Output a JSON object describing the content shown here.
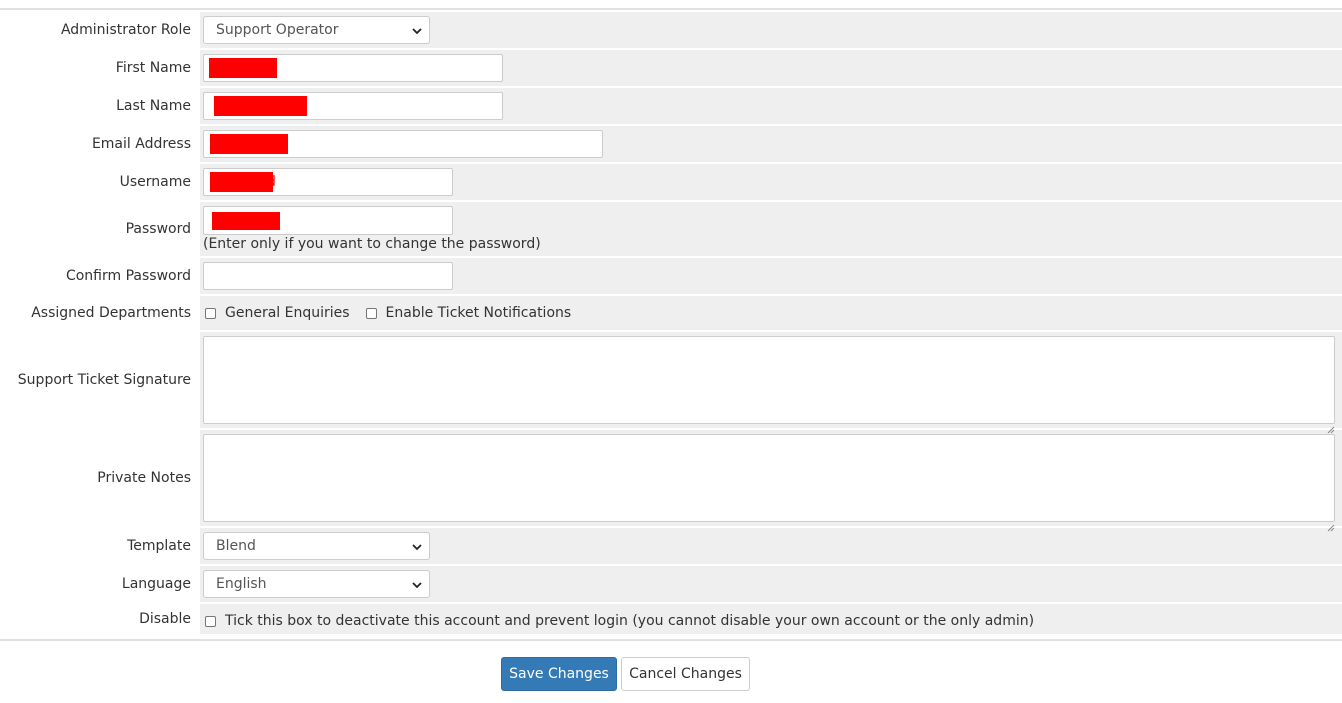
{
  "fields": {
    "admin_role": {
      "label": "Administrator Role",
      "value": "Support Operator"
    },
    "first_name": {
      "label": "First Name",
      "value": "Redacted"
    },
    "last_name": {
      "label": "Last Name",
      "value": "Redacted"
    },
    "email": {
      "label": "Email Address",
      "value": "Redacted"
    },
    "username": {
      "label": "Username",
      "value": "Redacted"
    },
    "password": {
      "label": "Password",
      "value": "Redacted",
      "help": "(Enter only if you want to change the password)"
    },
    "confirm_password": {
      "label": "Confirm Password",
      "value": ""
    },
    "departments": {
      "label": "Assigned Departments",
      "options": [
        {
          "label": "General Enquiries",
          "checked": false
        },
        {
          "label": "Enable Ticket Notifications",
          "checked": false
        }
      ]
    },
    "signature": {
      "label": "Support Ticket Signature",
      "value": ""
    },
    "private_notes": {
      "label": "Private Notes",
      "value": ""
    },
    "template": {
      "label": "Template",
      "value": "Blend"
    },
    "language": {
      "label": "Language",
      "value": "English"
    },
    "disable": {
      "label": "Disable",
      "checkbox_text": "Tick this box to deactivate this account and prevent login (you cannot disable your own account or the only admin)",
      "checked": false
    }
  },
  "actions": {
    "save": "Save Changes",
    "cancel": "Cancel Changes"
  },
  "colors": {
    "primary": "#337ab7",
    "redaction": "#ff0000",
    "field_bg": "#efefef"
  },
  "icons": {
    "select": "chevron-down-icon",
    "textarea": "resize-grip-icon"
  }
}
